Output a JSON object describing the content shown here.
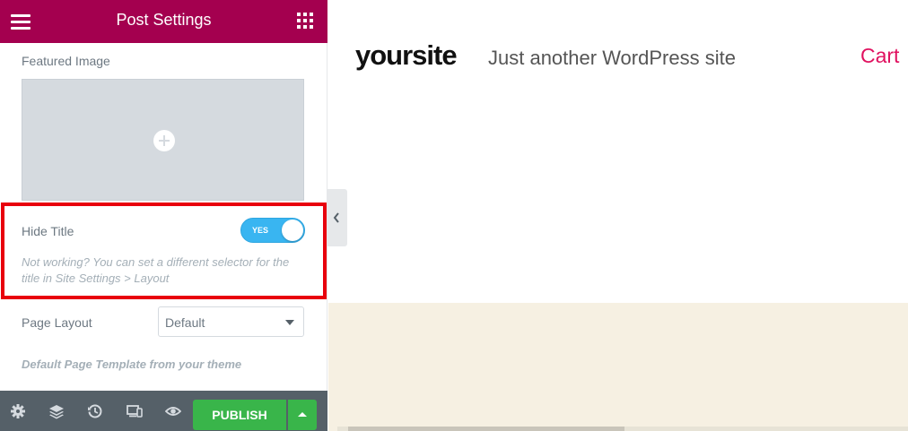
{
  "panel": {
    "title": "Post Settings",
    "featured_image": {
      "label": "Featured Image"
    },
    "hide_title": {
      "label": "Hide Title",
      "toggle_text": "YES",
      "enabled": true,
      "hint": "Not working? You can set a different selector for the title in Site Settings > Layout"
    },
    "page_layout": {
      "label": "Page Layout",
      "selected": "Default",
      "note": "Default Page Template from your theme"
    }
  },
  "footer": {
    "icons": [
      "settings-icon",
      "layers-icon",
      "history-icon",
      "responsive-icon",
      "preview-icon"
    ],
    "publish_label": "PUBLISH"
  },
  "preview": {
    "site_title": "yoursite",
    "tagline": "Just another WordPress site",
    "cart_label": "Cart"
  },
  "colors": {
    "header_bg": "#a4004f",
    "highlight_border": "#e8000d",
    "toggle_on": "#39b5f1",
    "publish_bg": "#39b54a",
    "cart_link": "#e0115f",
    "footer_bg": "#556068",
    "preview_band": "#f6f0e2"
  }
}
